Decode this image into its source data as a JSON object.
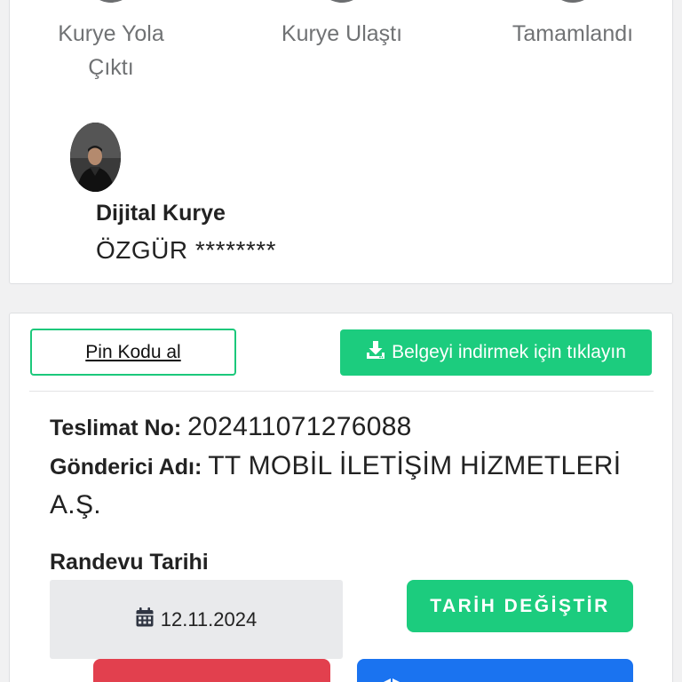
{
  "status_steps": [
    {
      "label_line1": "Kurye Yola",
      "label_line2": "Çıktı"
    },
    {
      "label_line1": "Kurye Ulaştı",
      "label_line2": ""
    },
    {
      "label_line1": "Tamamlandı",
      "label_line2": ""
    }
  ],
  "courier": {
    "title": "Dijital Kurye",
    "name": "ÖZGÜR ********"
  },
  "actions": {
    "pin_label": "Pin Kodu al",
    "download_label": "Belgeyi indirmek için tıklayın"
  },
  "delivery": {
    "tracking_label": "Teslimat No",
    "tracking_value": "202411071276088",
    "sender_label": "Gönderici Adı",
    "sender_value": "TT MOBİL İLETİŞİM HİZMETLERİ",
    "sender_value_cont": "A.Ş."
  },
  "appointment": {
    "label": "Randevu Tarihi",
    "date": "12.11.2024",
    "change_button": "TARİH DEĞİŞTİR"
  },
  "colors": {
    "green": "#1ccc7e",
    "red": "#e2404e",
    "blue": "#1a73f0"
  }
}
